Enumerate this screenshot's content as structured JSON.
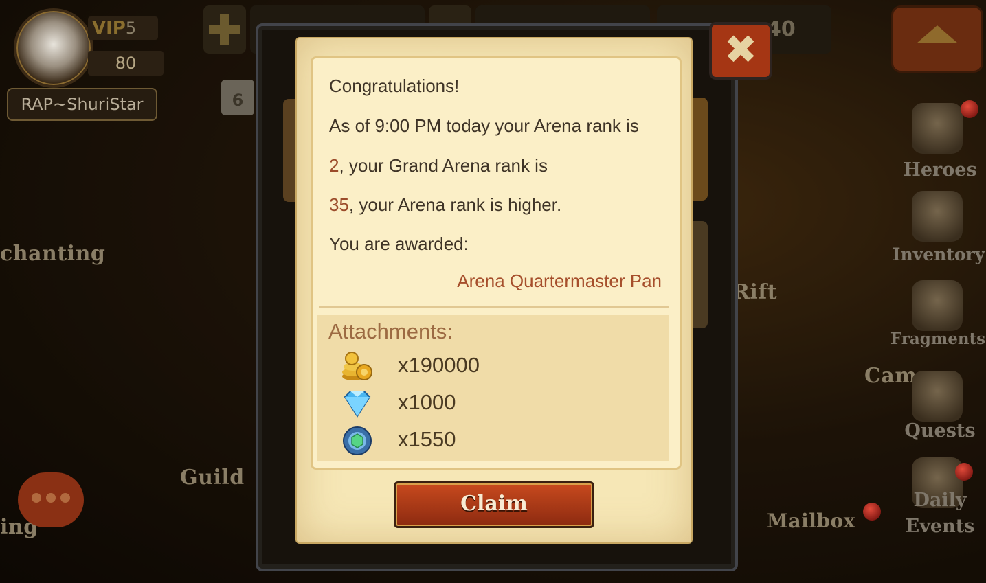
{
  "hud": {
    "vip_label": "VIP",
    "vip_level": "5",
    "player_level": "80",
    "player_name": "RAP~ShuriStar",
    "calendar_day": "6",
    "food_partial": "40"
  },
  "map_labels": {
    "enchanting": "chanting",
    "guild": "Guild",
    "rift": "Rift",
    "mailbox": "Mailbox",
    "camp": "Cam",
    "left_cut": "ing"
  },
  "side_menu": [
    {
      "label": "Heroes",
      "icon": "helmet-icon"
    },
    {
      "label": "Inventory",
      "icon": "backpack-icon"
    },
    {
      "label": "Fragments",
      "icon": "fragment-icon"
    },
    {
      "label": "Quests",
      "icon": "scroll-icon"
    },
    {
      "label": "Daily\nEvents",
      "icon": "gift-icon"
    }
  ],
  "mail": {
    "greeting": "Congratulations!",
    "line1": "As of 9:00 PM today your Arena rank is",
    "arena_rank": "2",
    "line2": ", your Grand Arena rank is",
    "grand_arena_rank": "35",
    "line3": ", your Arena rank is higher.",
    "line4": "You are awarded:",
    "sender": "Arena Quartermaster Pan",
    "attachments_title": "Attachments:",
    "attachments": [
      {
        "icon": "gold-coins-icon",
        "amount": "x190000"
      },
      {
        "icon": "diamond-icon",
        "amount": "x1000"
      },
      {
        "icon": "arena-token-icon",
        "amount": "x1550"
      }
    ],
    "claim_label": "Claim",
    "close_label": "✖"
  },
  "colors": {
    "parchment": "#f6e7b6",
    "highlight": "#9b4b2a",
    "claim_button": "#b5401a"
  }
}
